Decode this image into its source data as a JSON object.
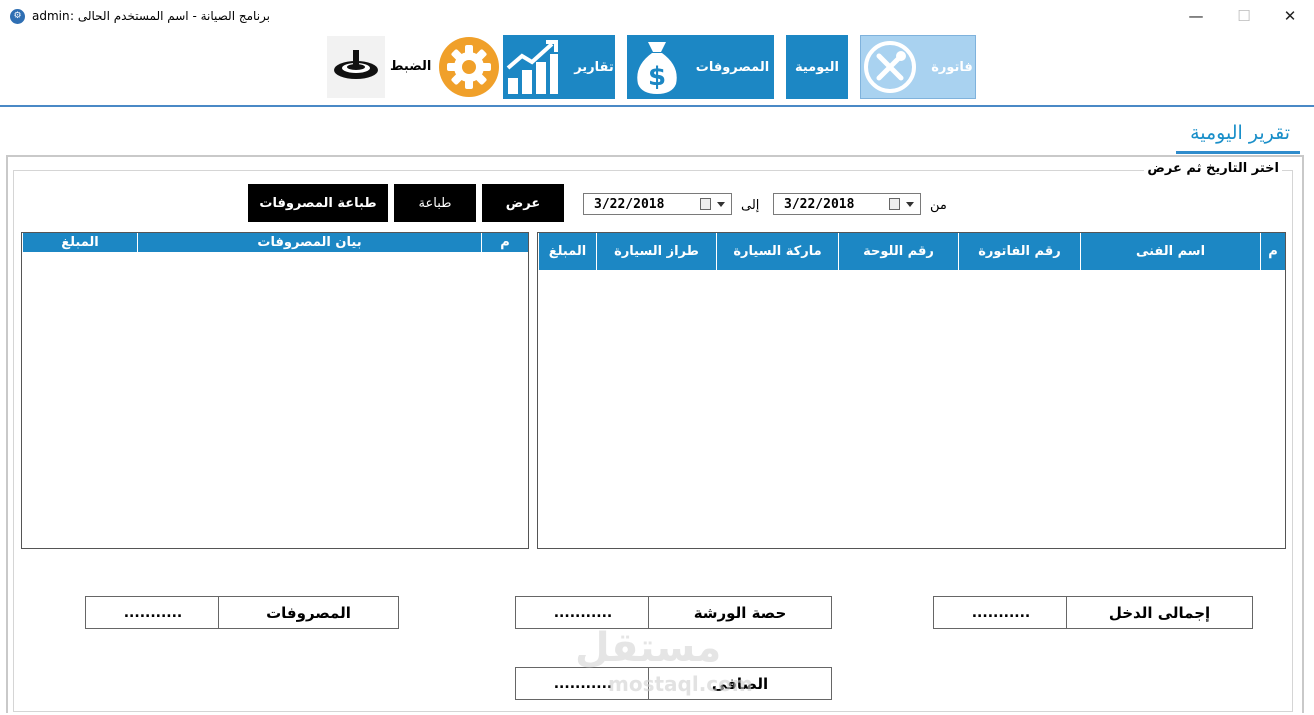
{
  "window": {
    "user": "admin",
    "title": "برنامج الصيانة  -  اسم المستخدم الحالى  :",
    "minimize": "—",
    "maximize": "☐",
    "close": "✕"
  },
  "toolbar": {
    "invoice": "فاتورة",
    "daily": "اليومية",
    "expenses": "المصروفات",
    "reports": "تقارير",
    "settings": "الضبط"
  },
  "page": {
    "title": "تقرير اليومية",
    "group_label": "اختر التاريخ ثم عرض"
  },
  "filter": {
    "from_label": "من",
    "to_label": "إلى",
    "from_date": "3/22/2018",
    "to_date": "3/22/2018",
    "show_button": "عرض",
    "print_button": "طباعة",
    "print_expenses_button": "طباعة المصروفات"
  },
  "invoices_grid": {
    "columns": [
      "م",
      "اسم الفنى",
      "رقم الفاتورة",
      "رقم اللوحة",
      "ماركة السيارة",
      "طراز السيارة",
      "المبلغ"
    ],
    "rows": []
  },
  "expenses_grid": {
    "columns": [
      "م",
      "بيان المصروفات",
      "المبلغ"
    ],
    "rows": []
  },
  "totals": {
    "income_label": "إجمالى الدخل",
    "income_value": "...........",
    "workshop_label": "حصة الورشة",
    "workshop_value": "...........",
    "expenses_label": "المصروفات",
    "expenses_value": "...........",
    "net_label": "الصافى",
    "net_value": "..........."
  },
  "watermark": {
    "arabic": "مستقل",
    "latin": "mostaql.com"
  },
  "colors": {
    "accent": "#1c87c4",
    "active_tab": "#a9d2f0",
    "settings_gear": "#f0a02a",
    "title": "#1a8fc9"
  }
}
